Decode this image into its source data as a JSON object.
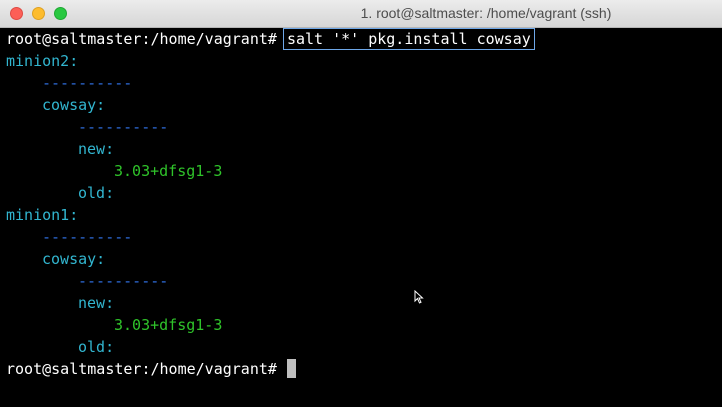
{
  "window": {
    "title": "1. root@saltmaster: /home/vagrant (ssh)"
  },
  "terminal": {
    "prompt": "root@saltmaster:/home/vagrant#",
    "command": "salt '*' pkg.install cowsay",
    "output": {
      "minion2": "minion2:",
      "minion2_sep": "----------",
      "minion2_pkg": "cowsay:",
      "minion2_pkg_sep": "----------",
      "minion2_new": "new:",
      "minion2_new_val": "3.03+dfsg1-3",
      "minion2_old": "old:",
      "minion1": "minion1:",
      "minion1_sep": "----------",
      "minion1_pkg": "cowsay:",
      "minion1_pkg_sep": "----------",
      "minion1_new": "new:",
      "minion1_new_val": "3.03+dfsg1-3",
      "minion1_old": "old:"
    },
    "final_prompt": "root@saltmaster:/home/vagrant#"
  },
  "colors": {
    "key": "#32b6d0",
    "separator": "#2f6fe0",
    "value": "#2fc32a",
    "prompt": "#ffffff"
  }
}
